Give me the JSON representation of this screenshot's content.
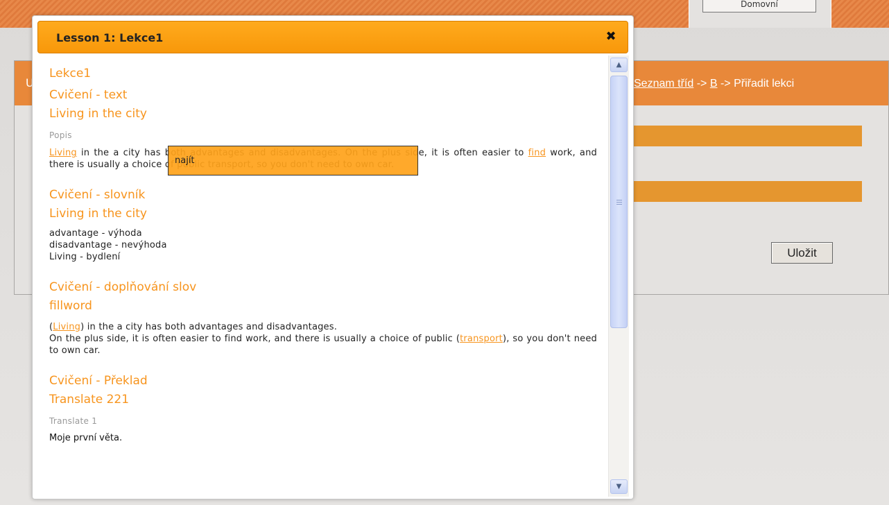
{
  "background": {
    "top_tab_button": "Domovní",
    "panel_letter": "U",
    "breadcrumb": {
      "link1": "Seznam tříd",
      "sep1": " -> ",
      "link2": "B",
      "sep2": " -> ",
      "current": "Přiřadit lekci"
    },
    "save_label": "Uložit"
  },
  "modal": {
    "title": "Lesson 1: Lekce1",
    "close_symbol": "✖",
    "lesson_name": "Lekce1",
    "exercises": [
      {
        "type_label": "Cvičení - text",
        "title": "Living in the city",
        "description": "Popis",
        "text_parts": {
          "link1": "Living",
          "seg1": " in the a city has both advantages and disadvantages. On the plus side, it is often easier to ",
          "link2": "find",
          "seg2": " work, and there is usually a choice of public transport, so you don't need to own car."
        }
      },
      {
        "type_label": "Cvičení - slovník",
        "title": "Living in the city",
        "vocabulary": [
          "advantage - výhoda",
          "disadvantage - nevýhoda",
          "Living - bydlení"
        ]
      },
      {
        "type_label": "Cvičení - doplňování slov",
        "title": "fillword",
        "text_parts": {
          "open1": "(",
          "word1": "Living",
          "seg1": ") in the a city has both advantages and disadvantages.",
          "seg2": "On the plus side, it is often easier to find work, and there is usually a choice of public (",
          "word2": "transport",
          "seg3": "), so you don't need to own car."
        }
      },
      {
        "type_label": "Cvičení - Překlad",
        "title": "Translate 221",
        "description": "Translate 1",
        "sentence": "Moje první věta."
      }
    ],
    "tooltip_label": "najít"
  },
  "scrollbar": {
    "up_symbol": "▲",
    "down_symbol": "▼",
    "position_fraction": 0
  },
  "colors": {
    "accent_orange": "#f7941d",
    "header_orange": "#ffaa1d",
    "panel_orange": "#e8883a",
    "field_orange": "#e5962f"
  }
}
